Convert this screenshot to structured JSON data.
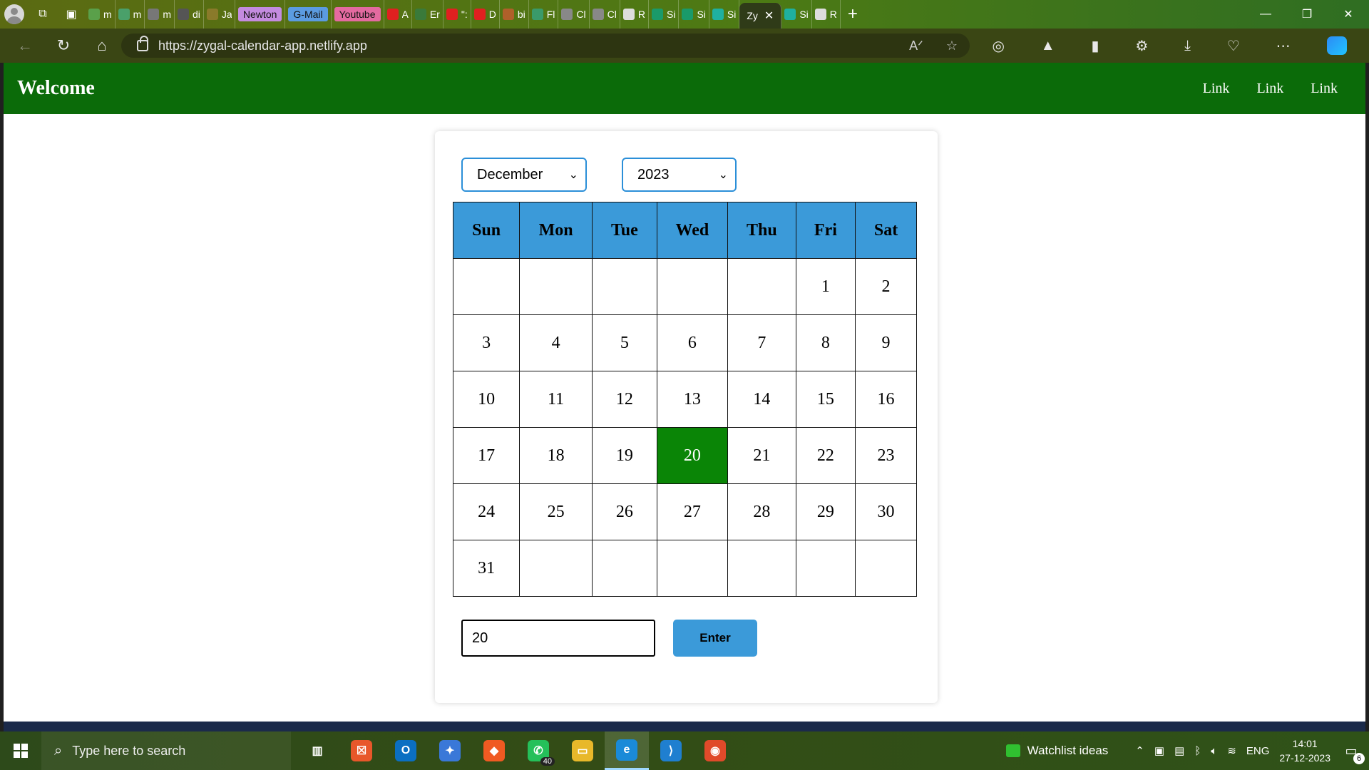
{
  "browser": {
    "tabs": [
      {
        "title": "m",
        "color": "#5aa04a"
      },
      {
        "title": "m",
        "color": "#4aa06a"
      },
      {
        "title": "m",
        "color": "#777"
      },
      {
        "title": "di",
        "color": "#555"
      },
      {
        "title": "Ja",
        "color": "#8a7a2a"
      },
      {
        "title": "Newton",
        "color": "#c48be0",
        "pill": true
      },
      {
        "title": "G-Mail",
        "color": "#5b9be0",
        "pill": true
      },
      {
        "title": "Youtube",
        "color": "#e46aa0",
        "pill": true
      },
      {
        "title": "A",
        "color": "#e02020"
      },
      {
        "title": "Er",
        "color": "#3a7a3a"
      },
      {
        "title": "\":",
        "color": "#e02020"
      },
      {
        "title": "D",
        "color": "#e02020"
      },
      {
        "title": "bi",
        "color": "#b0602a"
      },
      {
        "title": "Fl",
        "color": "#3a9a6a"
      },
      {
        "title": "Cl",
        "color": "#888"
      },
      {
        "title": "Cl",
        "color": "#888"
      },
      {
        "title": "R",
        "color": "#ddd"
      },
      {
        "title": "Si",
        "color": "#1a9a6a"
      },
      {
        "title": "Si",
        "color": "#1a9a6a"
      },
      {
        "title": "Si",
        "color": "#1fb0a0"
      }
    ],
    "active_tab": {
      "title": "Zy",
      "close": "✕"
    },
    "after_tabs": [
      {
        "title": "Si",
        "color": "#1fb0a0"
      },
      {
        "title": "R",
        "color": "#ddd"
      }
    ],
    "new_tab": "+",
    "url": "https://zygal-calendar-app.netlify.app",
    "window_controls": {
      "minimize": "—",
      "restore": "❐",
      "close": "✕"
    }
  },
  "app": {
    "brand": "Welcome",
    "nav_links": [
      "Link",
      "Link",
      "Link"
    ],
    "month_select": "December",
    "year_select": "2023",
    "weekdays": [
      "Sun",
      "Mon",
      "Tue",
      "Wed",
      "Thu",
      "Fri",
      "Sat"
    ],
    "weeks": [
      [
        "",
        "",
        "",
        "",
        "",
        "1",
        "2"
      ],
      [
        "3",
        "4",
        "5",
        "6",
        "7",
        "8",
        "9"
      ],
      [
        "10",
        "11",
        "12",
        "13",
        "14",
        "15",
        "16"
      ],
      [
        "17",
        "18",
        "19",
        "20",
        "21",
        "22",
        "23"
      ],
      [
        "24",
        "25",
        "26",
        "27",
        "28",
        "29",
        "30"
      ],
      [
        "31",
        "",
        "",
        "",
        "",
        "",
        ""
      ]
    ],
    "highlighted_day": "20",
    "day_input_value": "20",
    "enter_label": "Enter",
    "colors": {
      "navbar": "#0b6b09",
      "header": "#3b9ad9",
      "highlight": "#0a8506"
    }
  },
  "taskbar": {
    "search_placeholder": "Type here to search",
    "apps": [
      {
        "name": "task-view",
        "color": "transparent",
        "glyph": "▥"
      },
      {
        "name": "app-orange",
        "color": "#e8572a",
        "glyph": "☒"
      },
      {
        "name": "outlook",
        "color": "#0b6fc2",
        "glyph": "O"
      },
      {
        "name": "medal-app",
        "color": "#3a78d8",
        "glyph": "✦"
      },
      {
        "name": "brave",
        "color": "#f05a22",
        "glyph": "◆"
      },
      {
        "name": "whatsapp",
        "color": "#25c05a",
        "glyph": "✆",
        "badge": "40"
      },
      {
        "name": "file-explorer",
        "color": "#e8b82a",
        "glyph": "▭"
      },
      {
        "name": "edge",
        "color": "#1a8ad8",
        "glyph": "e",
        "active": true
      },
      {
        "name": "vscode",
        "color": "#1f7fd0",
        "glyph": "⟩"
      },
      {
        "name": "chrome",
        "color": "#e04a2a",
        "glyph": "◉"
      }
    ],
    "widget_text": "Watchlist ideas",
    "language": "ENG",
    "time": "14:01",
    "date": "27-12-2023",
    "notification_count": "6"
  }
}
